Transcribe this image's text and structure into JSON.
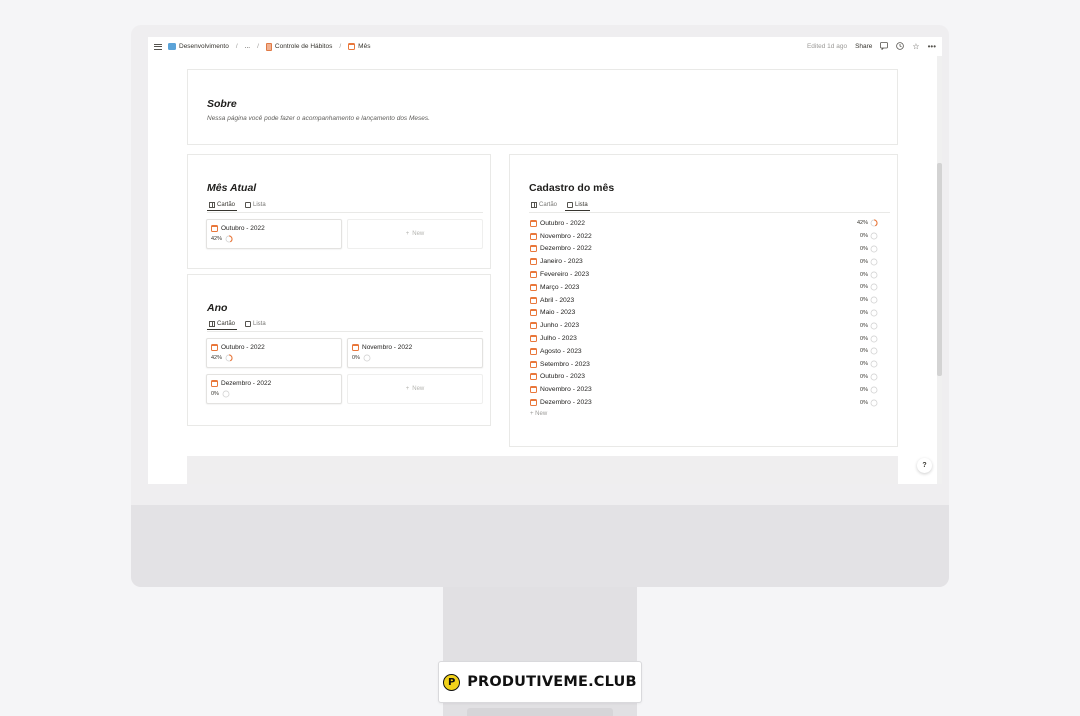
{
  "breadcrumb": {
    "items": [
      "Desenvolvimento",
      "...",
      "Controle de Hábitos",
      "Mês"
    ],
    "sep": "/"
  },
  "topbar": {
    "edited": "Edited 1d ago",
    "share": "Share"
  },
  "sobre": {
    "title": "Sobre",
    "description": "Nessa página você pode fazer o acompanhamento e lançamento dos Meses."
  },
  "mes_atual": {
    "title": "Mês Atual",
    "tabs": [
      "Cartão",
      "Lista"
    ],
    "cards": [
      {
        "title": "Outubro - 2022",
        "progress": "42%",
        "fraction": 0.42
      }
    ],
    "new_label": "New"
  },
  "ano": {
    "title": "Ano",
    "tabs": [
      "Cartão",
      "Lista"
    ],
    "cards": [
      {
        "title": "Outubro - 2022",
        "progress": "42%",
        "fraction": 0.42
      },
      {
        "title": "Novembro - 2022",
        "progress": "0%",
        "fraction": 0
      },
      {
        "title": "Dezembro - 2022",
        "progress": "0%",
        "fraction": 0
      }
    ],
    "new_label": "New"
  },
  "cadastro": {
    "title": "Cadastro do mês",
    "tabs": [
      "Cartão",
      "Lista"
    ],
    "rows": [
      {
        "label": "Outubro - 2022",
        "progress": "42%",
        "fraction": 0.42
      },
      {
        "label": "Novembro - 2022",
        "progress": "0%",
        "fraction": 0
      },
      {
        "label": "Dezembro - 2022",
        "progress": "0%",
        "fraction": 0
      },
      {
        "label": "Janeiro - 2023",
        "progress": "0%",
        "fraction": 0
      },
      {
        "label": "Fevereiro - 2023",
        "progress": "0%",
        "fraction": 0
      },
      {
        "label": "Março - 2023",
        "progress": "0%",
        "fraction": 0
      },
      {
        "label": "Abril - 2023",
        "progress": "0%",
        "fraction": 0
      },
      {
        "label": "Maio - 2023",
        "progress": "0%",
        "fraction": 0
      },
      {
        "label": "Junho - 2023",
        "progress": "0%",
        "fraction": 0
      },
      {
        "label": "Julho - 2023",
        "progress": "0%",
        "fraction": 0
      },
      {
        "label": "Agosto - 2023",
        "progress": "0%",
        "fraction": 0
      },
      {
        "label": "Setembro - 2023",
        "progress": "0%",
        "fraction": 0
      },
      {
        "label": "Outubro - 2023",
        "progress": "0%",
        "fraction": 0
      },
      {
        "label": "Novembro - 2023",
        "progress": "0%",
        "fraction": 0
      },
      {
        "label": "Dezembro - 2023",
        "progress": "0%",
        "fraction": 0
      }
    ],
    "new_label": "+ New"
  },
  "help": "?",
  "brand": {
    "text": "PRODUTIVEME.CLUB",
    "logo_letter": "P"
  },
  "colors": {
    "accent": "#e9773b",
    "ring_track": "#d3d3d3"
  }
}
